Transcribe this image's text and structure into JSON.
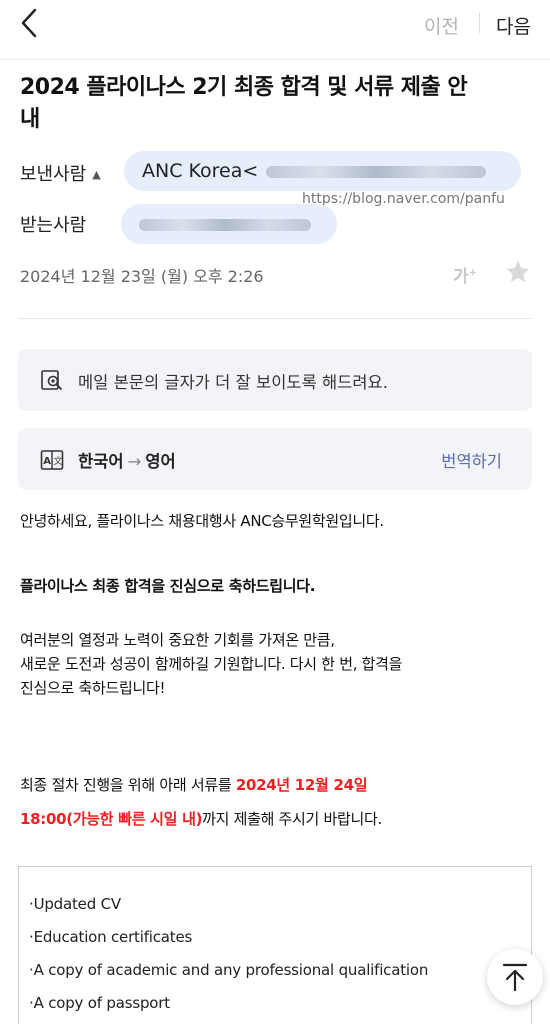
{
  "topbar": {
    "prev": "이전",
    "next": "다음"
  },
  "subject": "2024 플라이나스 2기 최종 합격 및 서류 제출 안내",
  "sender": {
    "label": "보낸사람",
    "name": "ANC Korea<"
  },
  "recipient": {
    "label": "받는사람"
  },
  "watermark": "https://blog.naver.com/panfu",
  "date": "2024년 12월 23일 (월) 오후 2:26",
  "font_size_button": "가",
  "readability_tip": "메일 본문의 글자가 더 잘 보이도록 해드려요.",
  "translate": {
    "from": "한국어",
    "to": "영어",
    "action": "번역하기"
  },
  "body": {
    "greeting": "안녕하세요, 플라이나스 채용대행사 ANC승무원학원입니다.",
    "congrats": "플라이나스 최종 합격을 진심으로 축하드립니다.",
    "para1_line1": "여러분의 열정과 노력이 중요한 기회를 가져온 만큼,",
    "para1_line2": "새로운 도전과 성공이 함께하길 기원합니다. 다시 한 번, 합격을",
    "para1_line3": "진심으로 축하드립니다!",
    "para2_prefix": "최종 절차 진행을 위해 아래 서류를 ",
    "para2_deadline_date": "2024년 12월 24일",
    "para2_deadline_time": "18:00(가능한 빠른 시일 내)",
    "para2_suffix": "까지 제출해 주시기 바랍니다."
  },
  "documents": [
    "·Updated CV",
    "·Education certificates",
    "·A copy of academic and any professional qualification",
    "·A copy of passport"
  ],
  "colors": {
    "accent_red": "#f02020",
    "chip_bg": "#e6eefc",
    "link_blue": "#5b6bb8"
  }
}
